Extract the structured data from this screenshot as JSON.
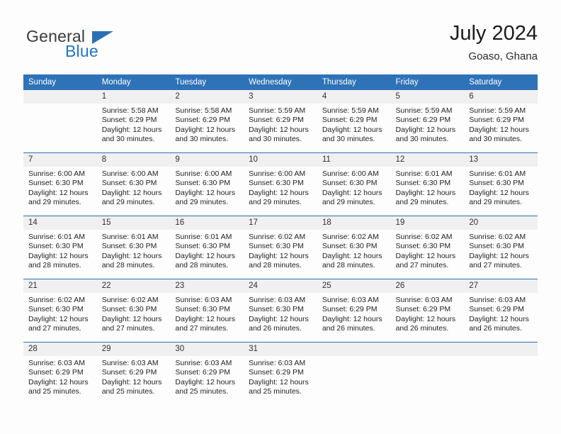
{
  "brand": {
    "name_part1": "General",
    "name_part2": "Blue",
    "logo_icon": "triangle-flag-icon",
    "accent_color": "#2175c4",
    "header_blue": "#2e72b8"
  },
  "header": {
    "title": "July 2024",
    "subtitle": "Goaso, Ghana"
  },
  "calendar": {
    "weekdays": [
      "Sunday",
      "Monday",
      "Tuesday",
      "Wednesday",
      "Thursday",
      "Friday",
      "Saturday"
    ],
    "weeks": [
      [
        {
          "day": "",
          "sunrise": "",
          "sunset": "",
          "daylight1": "",
          "daylight2": "",
          "empty": true
        },
        {
          "day": "1",
          "sunrise": "Sunrise: 5:58 AM",
          "sunset": "Sunset: 6:29 PM",
          "daylight1": "Daylight: 12 hours",
          "daylight2": "and 30 minutes."
        },
        {
          "day": "2",
          "sunrise": "Sunrise: 5:58 AM",
          "sunset": "Sunset: 6:29 PM",
          "daylight1": "Daylight: 12 hours",
          "daylight2": "and 30 minutes."
        },
        {
          "day": "3",
          "sunrise": "Sunrise: 5:59 AM",
          "sunset": "Sunset: 6:29 PM",
          "daylight1": "Daylight: 12 hours",
          "daylight2": "and 30 minutes."
        },
        {
          "day": "4",
          "sunrise": "Sunrise: 5:59 AM",
          "sunset": "Sunset: 6:29 PM",
          "daylight1": "Daylight: 12 hours",
          "daylight2": "and 30 minutes."
        },
        {
          "day": "5",
          "sunrise": "Sunrise: 5:59 AM",
          "sunset": "Sunset: 6:29 PM",
          "daylight1": "Daylight: 12 hours",
          "daylight2": "and 30 minutes."
        },
        {
          "day": "6",
          "sunrise": "Sunrise: 5:59 AM",
          "sunset": "Sunset: 6:29 PM",
          "daylight1": "Daylight: 12 hours",
          "daylight2": "and 30 minutes."
        }
      ],
      [
        {
          "day": "7",
          "sunrise": "Sunrise: 6:00 AM",
          "sunset": "Sunset: 6:30 PM",
          "daylight1": "Daylight: 12 hours",
          "daylight2": "and 29 minutes."
        },
        {
          "day": "8",
          "sunrise": "Sunrise: 6:00 AM",
          "sunset": "Sunset: 6:30 PM",
          "daylight1": "Daylight: 12 hours",
          "daylight2": "and 29 minutes."
        },
        {
          "day": "9",
          "sunrise": "Sunrise: 6:00 AM",
          "sunset": "Sunset: 6:30 PM",
          "daylight1": "Daylight: 12 hours",
          "daylight2": "and 29 minutes."
        },
        {
          "day": "10",
          "sunrise": "Sunrise: 6:00 AM",
          "sunset": "Sunset: 6:30 PM",
          "daylight1": "Daylight: 12 hours",
          "daylight2": "and 29 minutes."
        },
        {
          "day": "11",
          "sunrise": "Sunrise: 6:00 AM",
          "sunset": "Sunset: 6:30 PM",
          "daylight1": "Daylight: 12 hours",
          "daylight2": "and 29 minutes."
        },
        {
          "day": "12",
          "sunrise": "Sunrise: 6:01 AM",
          "sunset": "Sunset: 6:30 PM",
          "daylight1": "Daylight: 12 hours",
          "daylight2": "and 29 minutes."
        },
        {
          "day": "13",
          "sunrise": "Sunrise: 6:01 AM",
          "sunset": "Sunset: 6:30 PM",
          "daylight1": "Daylight: 12 hours",
          "daylight2": "and 29 minutes."
        }
      ],
      [
        {
          "day": "14",
          "sunrise": "Sunrise: 6:01 AM",
          "sunset": "Sunset: 6:30 PM",
          "daylight1": "Daylight: 12 hours",
          "daylight2": "and 28 minutes."
        },
        {
          "day": "15",
          "sunrise": "Sunrise: 6:01 AM",
          "sunset": "Sunset: 6:30 PM",
          "daylight1": "Daylight: 12 hours",
          "daylight2": "and 28 minutes."
        },
        {
          "day": "16",
          "sunrise": "Sunrise: 6:01 AM",
          "sunset": "Sunset: 6:30 PM",
          "daylight1": "Daylight: 12 hours",
          "daylight2": "and 28 minutes."
        },
        {
          "day": "17",
          "sunrise": "Sunrise: 6:02 AM",
          "sunset": "Sunset: 6:30 PM",
          "daylight1": "Daylight: 12 hours",
          "daylight2": "and 28 minutes."
        },
        {
          "day": "18",
          "sunrise": "Sunrise: 6:02 AM",
          "sunset": "Sunset: 6:30 PM",
          "daylight1": "Daylight: 12 hours",
          "daylight2": "and 28 minutes."
        },
        {
          "day": "19",
          "sunrise": "Sunrise: 6:02 AM",
          "sunset": "Sunset: 6:30 PM",
          "daylight1": "Daylight: 12 hours",
          "daylight2": "and 27 minutes."
        },
        {
          "day": "20",
          "sunrise": "Sunrise: 6:02 AM",
          "sunset": "Sunset: 6:30 PM",
          "daylight1": "Daylight: 12 hours",
          "daylight2": "and 27 minutes."
        }
      ],
      [
        {
          "day": "21",
          "sunrise": "Sunrise: 6:02 AM",
          "sunset": "Sunset: 6:30 PM",
          "daylight1": "Daylight: 12 hours",
          "daylight2": "and 27 minutes."
        },
        {
          "day": "22",
          "sunrise": "Sunrise: 6:02 AM",
          "sunset": "Sunset: 6:30 PM",
          "daylight1": "Daylight: 12 hours",
          "daylight2": "and 27 minutes."
        },
        {
          "day": "23",
          "sunrise": "Sunrise: 6:03 AM",
          "sunset": "Sunset: 6:30 PM",
          "daylight1": "Daylight: 12 hours",
          "daylight2": "and 27 minutes."
        },
        {
          "day": "24",
          "sunrise": "Sunrise: 6:03 AM",
          "sunset": "Sunset: 6:30 PM",
          "daylight1": "Daylight: 12 hours",
          "daylight2": "and 26 minutes."
        },
        {
          "day": "25",
          "sunrise": "Sunrise: 6:03 AM",
          "sunset": "Sunset: 6:29 PM",
          "daylight1": "Daylight: 12 hours",
          "daylight2": "and 26 minutes."
        },
        {
          "day": "26",
          "sunrise": "Sunrise: 6:03 AM",
          "sunset": "Sunset: 6:29 PM",
          "daylight1": "Daylight: 12 hours",
          "daylight2": "and 26 minutes."
        },
        {
          "day": "27",
          "sunrise": "Sunrise: 6:03 AM",
          "sunset": "Sunset: 6:29 PM",
          "daylight1": "Daylight: 12 hours",
          "daylight2": "and 26 minutes."
        }
      ],
      [
        {
          "day": "28",
          "sunrise": "Sunrise: 6:03 AM",
          "sunset": "Sunset: 6:29 PM",
          "daylight1": "Daylight: 12 hours",
          "daylight2": "and 25 minutes."
        },
        {
          "day": "29",
          "sunrise": "Sunrise: 6:03 AM",
          "sunset": "Sunset: 6:29 PM",
          "daylight1": "Daylight: 12 hours",
          "daylight2": "and 25 minutes."
        },
        {
          "day": "30",
          "sunrise": "Sunrise: 6:03 AM",
          "sunset": "Sunset: 6:29 PM",
          "daylight1": "Daylight: 12 hours",
          "daylight2": "and 25 minutes."
        },
        {
          "day": "31",
          "sunrise": "Sunrise: 6:03 AM",
          "sunset": "Sunset: 6:29 PM",
          "daylight1": "Daylight: 12 hours",
          "daylight2": "and 25 minutes."
        },
        {
          "day": "",
          "sunrise": "",
          "sunset": "",
          "daylight1": "",
          "daylight2": "",
          "empty": true
        },
        {
          "day": "",
          "sunrise": "",
          "sunset": "",
          "daylight1": "",
          "daylight2": "",
          "empty": true
        },
        {
          "day": "",
          "sunrise": "",
          "sunset": "",
          "daylight1": "",
          "daylight2": "",
          "empty": true
        }
      ]
    ]
  }
}
